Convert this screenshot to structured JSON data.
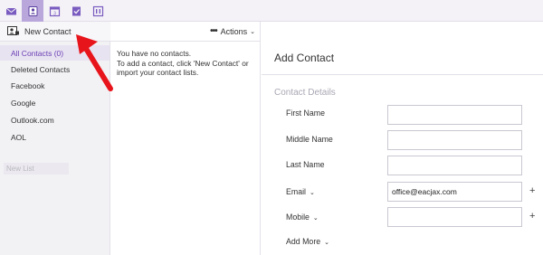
{
  "app_bar": {
    "icons": [
      "mail-icon",
      "contacts-icon",
      "calendar-icon",
      "tasks-icon",
      "notes-icon"
    ],
    "active": "contacts-icon",
    "accent_color": "#b9a7dc"
  },
  "left_nav": {
    "new_contact_label": "New Contact",
    "items": [
      {
        "label": "All Contacts (0)",
        "selected": true
      },
      {
        "label": "Deleted Contacts",
        "selected": false
      },
      {
        "label": "Facebook",
        "selected": false
      },
      {
        "label": "Google",
        "selected": false
      },
      {
        "label": "Outlook.com",
        "selected": false
      },
      {
        "label": "AOL",
        "selected": false
      }
    ],
    "new_list_placeholder": "New List"
  },
  "middle": {
    "actions_label": "Actions",
    "empty_line1": "You have no contacts.",
    "empty_line2": "To add a contact, click 'New Contact' or import your contact lists."
  },
  "add_contact": {
    "title": "Add Contact",
    "section": "Contact Details",
    "fields": [
      {
        "label": "First Name",
        "value": "",
        "has_dropdown": false,
        "has_plus": false
      },
      {
        "label": "Middle Name",
        "value": "",
        "has_dropdown": false,
        "has_plus": false
      },
      {
        "label": "Last Name",
        "value": "",
        "has_dropdown": false,
        "has_plus": false
      },
      {
        "label": "Email",
        "value": "office@eacjax.com",
        "has_dropdown": true,
        "has_plus": true
      },
      {
        "label": "Mobile",
        "value": "",
        "has_dropdown": true,
        "has_plus": true
      }
    ],
    "add_more_label": "Add More",
    "plus_symbol": "+"
  }
}
